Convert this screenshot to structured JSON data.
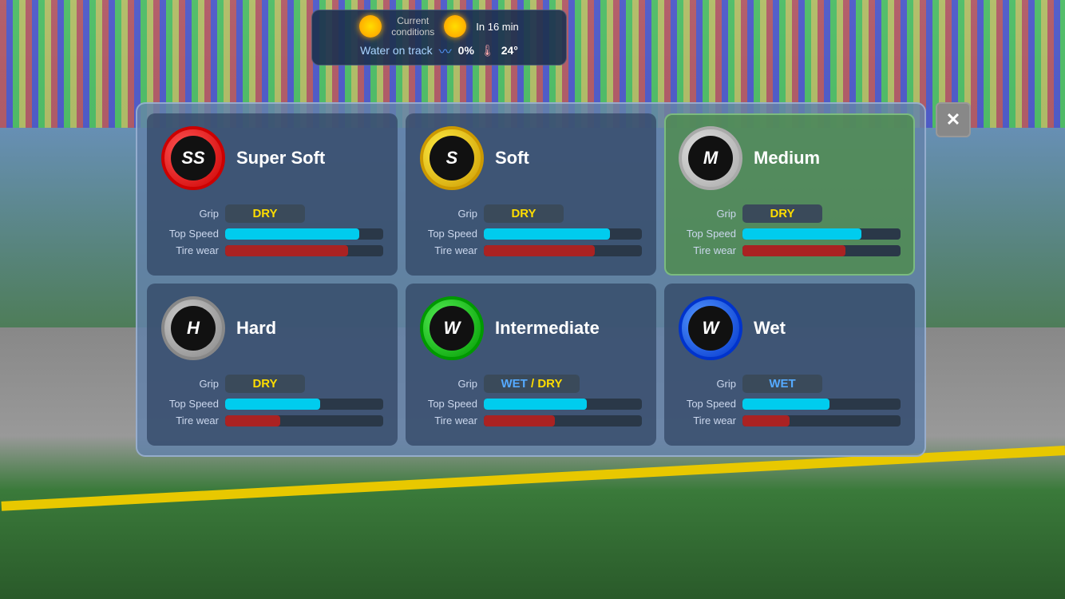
{
  "weather": {
    "current_label": "Current",
    "conditions_label": "conditions",
    "in_time_label": "In 16 min",
    "water_label": "Water on track",
    "water_percent": "0%",
    "temperature": "24°"
  },
  "panel": {
    "close_label": "✕"
  },
  "tires": [
    {
      "id": "super-soft",
      "letter": "SS",
      "name": "Super Soft",
      "color_class": "tire-ss",
      "grip_type": "DRY",
      "grip_class": "grip-dry",
      "top_speed_pct": 85,
      "tire_wear_pct": 78,
      "selected": false
    },
    {
      "id": "soft",
      "letter": "S",
      "name": "Soft",
      "color_class": "tire-s",
      "grip_type": "DRY",
      "grip_class": "grip-dry",
      "top_speed_pct": 80,
      "tire_wear_pct": 70,
      "selected": false
    },
    {
      "id": "medium",
      "letter": "M",
      "name": "Medium",
      "color_class": "tire-m",
      "grip_type": "DRY",
      "grip_class": "grip-dry",
      "top_speed_pct": 75,
      "tire_wear_pct": 65,
      "selected": true
    },
    {
      "id": "hard",
      "letter": "H",
      "name": "Hard",
      "color_class": "tire-h",
      "grip_type": "DRY",
      "grip_class": "grip-dry",
      "top_speed_pct": 60,
      "tire_wear_pct": 35,
      "selected": false
    },
    {
      "id": "intermediate",
      "letter": "W",
      "name": "Intermediate",
      "color_class": "tire-i",
      "grip_type": "WET_DRY",
      "grip_class": "",
      "top_speed_pct": 65,
      "tire_wear_pct": 45,
      "selected": false
    },
    {
      "id": "wet",
      "letter": "W",
      "name": "Wet",
      "color_class": "tire-w",
      "grip_type": "WET",
      "grip_class": "grip-wet",
      "top_speed_pct": 55,
      "tire_wear_pct": 30,
      "selected": false
    }
  ],
  "labels": {
    "grip": "Grip",
    "top_speed": "Top Speed",
    "tire_wear": "Tire wear",
    "wet": "WET",
    "slash": "/ ",
    "dry": "DRY"
  }
}
